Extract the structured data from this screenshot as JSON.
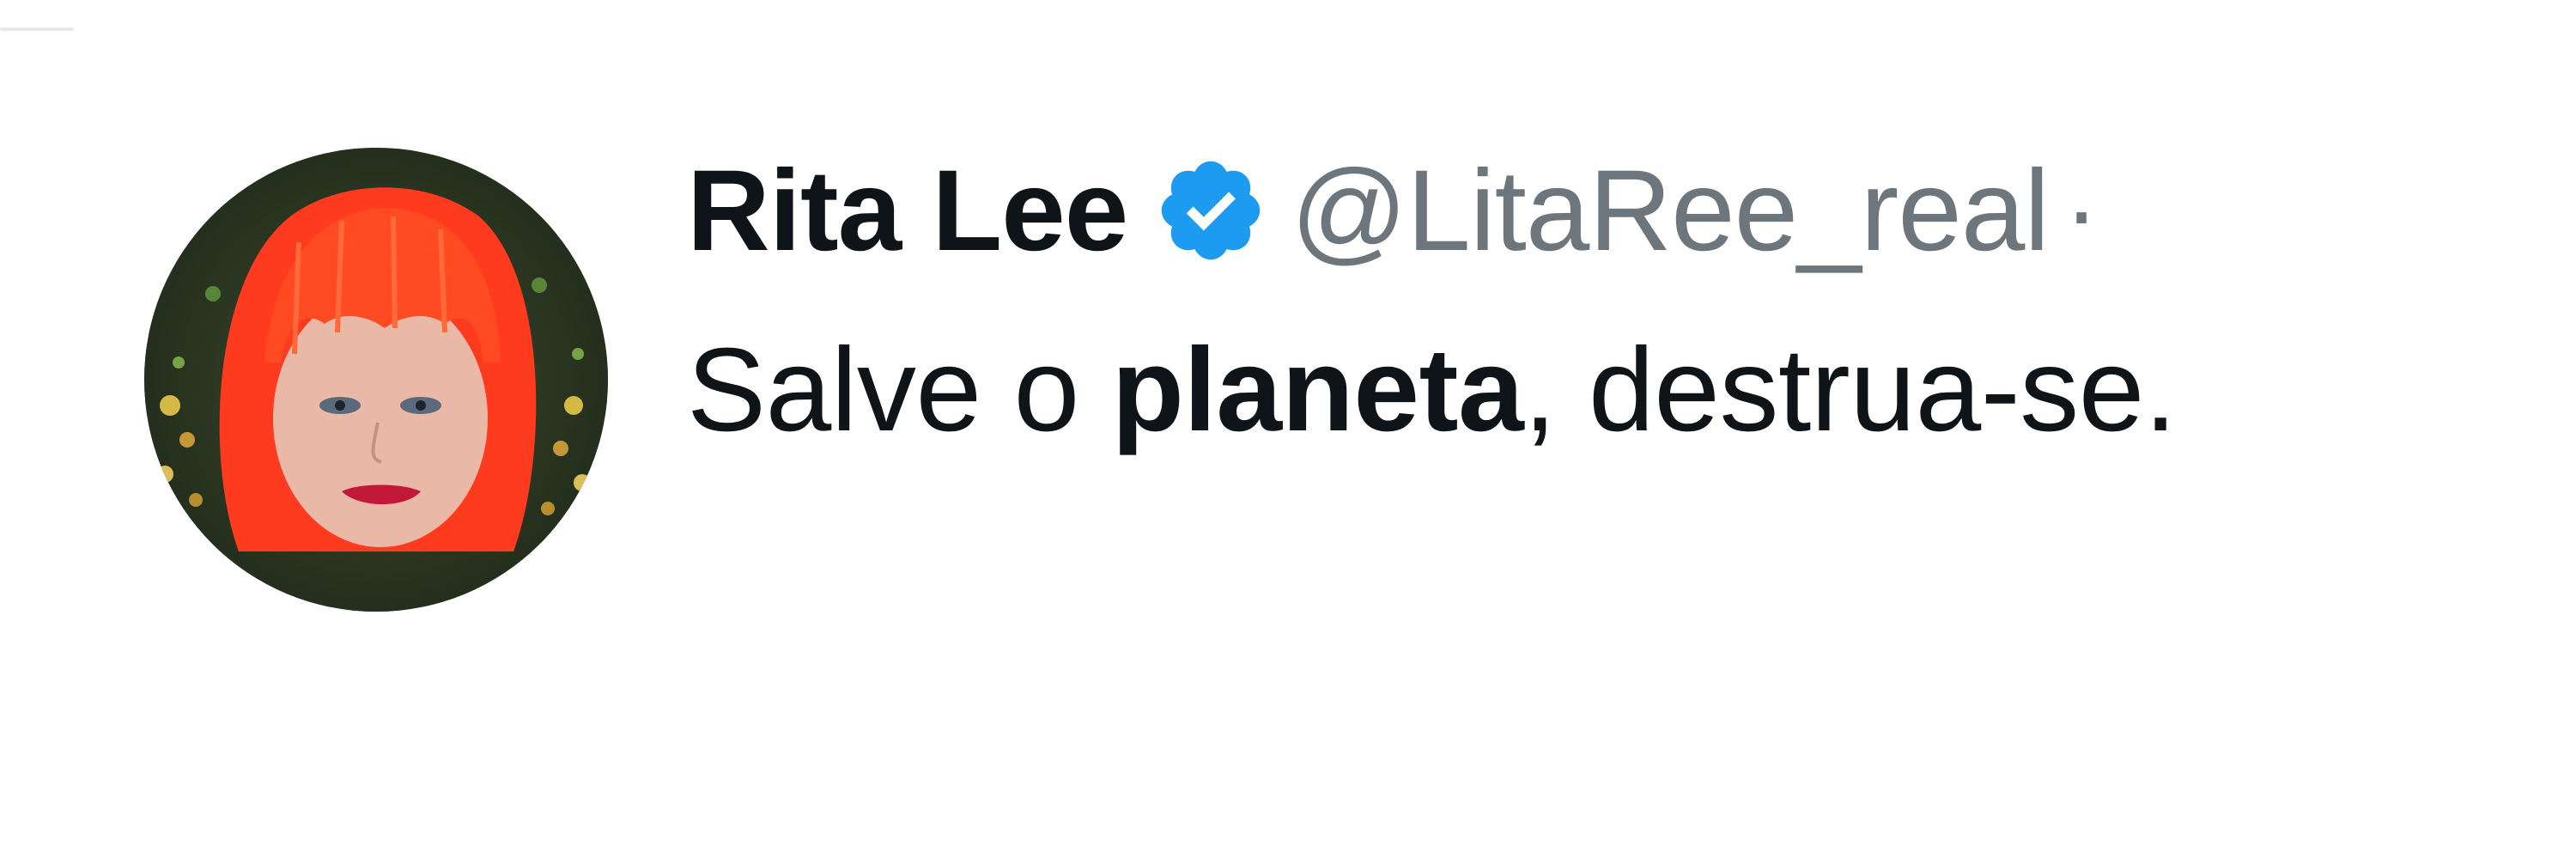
{
  "tweet": {
    "display_name": "Rita Lee",
    "handle": "@LitaRee_real",
    "separator": "·",
    "verified": true,
    "text_before": "Salve o ",
    "text_bold": "planeta",
    "text_after": ", destrua-se."
  },
  "colors": {
    "verified_badge": "#1d9bf0",
    "name_text": "#0f1419",
    "handle_text": "#6e767d",
    "avatar_hair": "#ff3b1f"
  },
  "icons": {
    "verified": "verified-badge-icon",
    "avatar": "avatar-image"
  }
}
